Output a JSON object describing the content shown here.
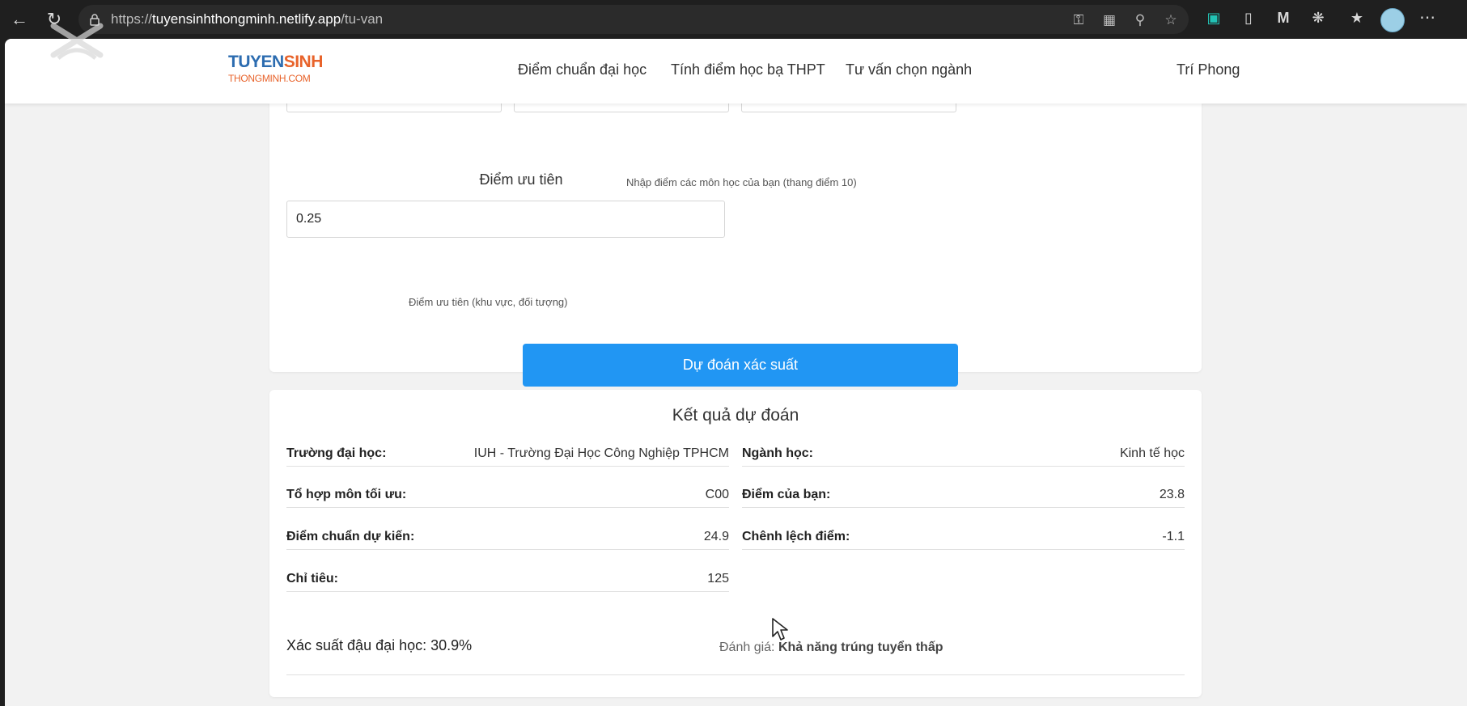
{
  "browser": {
    "url_prefix": "https://",
    "url_host": "tuyensinhthongminh.netlify.app",
    "url_path": "/tu-van",
    "icons": [
      "back-icon",
      "reload-icon",
      "lock-icon",
      "key-icon",
      "apps-icon",
      "zoom-icon",
      "star-icon",
      "extension-1-icon",
      "phone-icon",
      "malwarebytes-icon",
      "puzzle-icon",
      "favorites-icon",
      "avatar",
      "more-icon"
    ]
  },
  "header": {
    "logo_line1_a": "TUYEN",
    "logo_line1_b": "SINH",
    "logo_line2": "THONGMINH.COM",
    "nav": [
      "Điểm chuẩn đại học",
      "Tính điểm học bạ THPT",
      "Tư vấn chọn ngành"
    ],
    "user": "Trí Phong"
  },
  "form": {
    "scores_helper": "Nhập điểm các môn học của bạn (thang điểm 10)",
    "priority_label": "Điểm ưu tiên",
    "priority_value": "0.25",
    "priority_helper": "Điểm ưu tiên (khu vực, đối tượng)",
    "submit_label": "Dự đoán xác suất"
  },
  "result": {
    "title": "Kết quả dự đoán",
    "left": [
      {
        "label": "Trường đại học:",
        "value": "IUH - Trường Đại Học Công Nghiệp TPHCM"
      },
      {
        "label": "Tổ hợp môn tối ưu:",
        "value": "C00"
      },
      {
        "label": "Điểm chuẩn dự kiến:",
        "value": "24.9"
      },
      {
        "label": "Chỉ tiêu:",
        "value": "125"
      }
    ],
    "right": [
      {
        "label": "Ngành học:",
        "value": "Kinh tế học"
      },
      {
        "label": "Điểm của bạn:",
        "value": "23.8"
      },
      {
        "label": "Chênh lệch điểm:",
        "value": "-1.1"
      }
    ],
    "probability": "Xác suất đậu đại học: 30.9%",
    "evaluation_label": "Đánh giá:",
    "evaluation_value": "Khả năng trúng tuyển thấp"
  },
  "colors": {
    "primary": "#2196f3",
    "logo_blue": "#2c6cb0",
    "logo_orange": "#e8632b"
  }
}
